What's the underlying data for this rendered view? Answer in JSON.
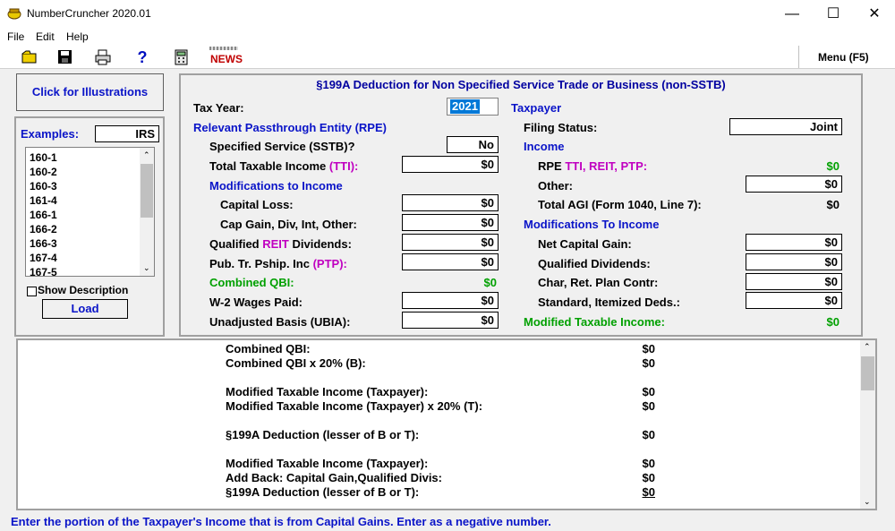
{
  "window": {
    "title": "NumberCruncher 2020.01",
    "minimize": "—",
    "maximize": "☐",
    "close": "✕"
  },
  "menu": {
    "file": "File",
    "edit": "Edit",
    "help": "Help"
  },
  "toolbar": {
    "news": "NEWS",
    "menu_f5": "Menu (F5)",
    "help_glyph": "?"
  },
  "left": {
    "illustrations_button": "Click for Illustrations",
    "examples_label": "Examples:",
    "examples_source": "IRS",
    "examples": [
      "160-1",
      "160-2",
      "160-3",
      "161-4",
      "166-1",
      "166-2",
      "166-3",
      "167-4",
      "167-5"
    ],
    "show_description": "Show Description",
    "load_button": "Load"
  },
  "form": {
    "title": "§199A Deduction for Non Specified Service Trade or Business (non-SSTB)",
    "tax_year_label": "Tax Year:",
    "tax_year_value": "2021",
    "rpe_heading": "Relevant Passthrough Entity (RPE)",
    "sstb_label": "Specified Service (SSTB)?",
    "sstb_value": "No",
    "tti_label": "Total Taxable Income ",
    "tti_suffix": "(TTI):",
    "tti_value": "$0",
    "mods_heading": "Modifications to Income",
    "cap_loss_label": "Capital Loss:",
    "cap_loss_value": "$0",
    "cap_gain_label": "Cap Gain, Div, Int, Other:",
    "cap_gain_value": "$0",
    "reit_pre": "Qualified ",
    "reit_mid": "REIT",
    "reit_post": " Dividends:",
    "reit_value": "$0",
    "ptp_label": "Pub. Tr. Pship. Inc ",
    "ptp_suffix": "(PTP):",
    "ptp_value": "$0",
    "combined_qbi_label": "Combined QBI:",
    "combined_qbi_value": "$0",
    "w2_label": "W-2 Wages Paid:",
    "w2_value": "$0",
    "ubia_label": "Unadjusted Basis (UBIA):",
    "ubia_value": "$0",
    "taxpayer_heading": "Taxpayer",
    "filing_status_label": "Filing Status:",
    "filing_status_value": "Joint",
    "income_heading": "Income",
    "rpe_income_pre": "RPE ",
    "rpe_income_suffix": "TTI, REIT, PTP:",
    "rpe_income_value": "$0",
    "other_label": "Other:",
    "other_value": "$0",
    "agi_label": "Total AGI (Form 1040, Line 7):",
    "agi_value": "$0",
    "mods2_heading": "Modifications To Income",
    "net_cap_gain_label": "Net Capital Gain:",
    "net_cap_gain_value": "$0",
    "qual_div_label": "Qualified Dividends:",
    "qual_div_value": "$0",
    "char_label": "Char, Ret. Plan Contr:",
    "char_value": "$0",
    "std_label": "Standard, Itemized Deds.:",
    "std_value": "$0",
    "mti_label": "Modified Taxable Income:",
    "mti_value": "$0"
  },
  "output": [
    {
      "label": "Combined QBI:",
      "value": "$0"
    },
    {
      "label": "Combined QBI x 20% (B):",
      "value": "$0"
    },
    {
      "label": "Modified Taxable Income (Taxpayer):",
      "value": "$0"
    },
    {
      "label": "Modified Taxable Income (Taxpayer) x 20% (T):",
      "value": "$0"
    },
    {
      "label": "§199A Deduction (lesser of B or T):",
      "value": "$0"
    },
    {
      "label": "Modified Taxable Income (Taxpayer):",
      "value": "$0"
    },
    {
      "label": "Add Back: Capital Gain,Qualified Divis:",
      "value": "$0"
    },
    {
      "label": "§199A Deduction (lesser of B or T):",
      "value": "$0"
    }
  ],
  "status": "Enter the portion of the Taxpayer's Income that is from Capital Gains.  Enter as a negative number."
}
